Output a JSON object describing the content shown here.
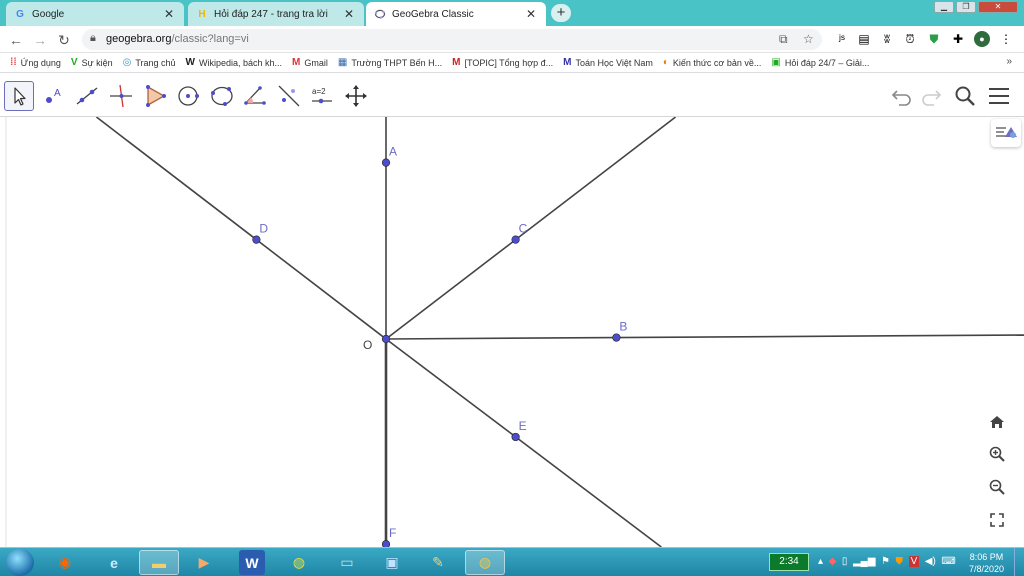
{
  "browser": {
    "tabs": [
      {
        "favicon": "G",
        "title": "Google",
        "active": false
      },
      {
        "favicon": "H",
        "title": "Hỏi đáp 247 - trang tra lời",
        "active": false
      },
      {
        "favicon": "geogebra-icon",
        "title": "GeoGebra Classic",
        "active": true
      }
    ],
    "new_tab_label": "+",
    "url_host": "geogebra.org",
    "url_path": "/classic?lang=vi",
    "bookmarks": [
      {
        "icon": "apps-icon",
        "label": "Ứng dụng"
      },
      {
        "icon": "V",
        "label": "Sự kiện"
      },
      {
        "icon": "home-icon",
        "label": "Trang chủ"
      },
      {
        "icon": "W",
        "label": "Wikipedia, bách kh..."
      },
      {
        "icon": "M",
        "label": "Gmail"
      },
      {
        "icon": "school-icon",
        "label": "Trường THPT Bến H..."
      },
      {
        "icon": "M",
        "label": "[TOPIC] Tổng hợp đ..."
      },
      {
        "icon": "M",
        "label": "Toán Học Việt Nam"
      },
      {
        "icon": "book-icon",
        "label": "Kiến thức cơ bản về..."
      },
      {
        "icon": "H",
        "label": "Hỏi đáp 24/7 – Giải..."
      }
    ],
    "bookmarks_more": "»"
  },
  "geogebra": {
    "points": [
      {
        "name": "A",
        "x": 0,
        "y": 2.45
      },
      {
        "name": "C",
        "x": 1.8,
        "y": 1.38
      },
      {
        "name": "D",
        "x": -1.8,
        "y": 1.38
      },
      {
        "name": "B",
        "x": 3.2,
        "y": 0.02
      },
      {
        "name": "E",
        "x": 1.8,
        "y": -1.36
      },
      {
        "name": "F",
        "x": 0,
        "y": -2.85
      }
    ],
    "origin": {
      "name": "O",
      "x": 0,
      "y": 0
    },
    "colors": {
      "point": "#4d4dcc",
      "point_label": "#6c6cc4",
      "line": "#444444",
      "accent": "#6e6ebf"
    },
    "tools": [
      "move-tool-icon",
      "point-tool-icon",
      "line-tool-icon",
      "perpendicular-tool-icon",
      "polygon-tool-icon",
      "circle-center-tool-icon",
      "circle-three-points-tool-icon",
      "angle-tool-icon",
      "reflect-tool-icon",
      "slider-tool-icon",
      "move-graphics-tool-icon"
    ],
    "slider_tool_label": "a=2"
  },
  "taskbar": {
    "timer": "2:34",
    "time": "8:06 PM",
    "date": "7/8/2020"
  }
}
